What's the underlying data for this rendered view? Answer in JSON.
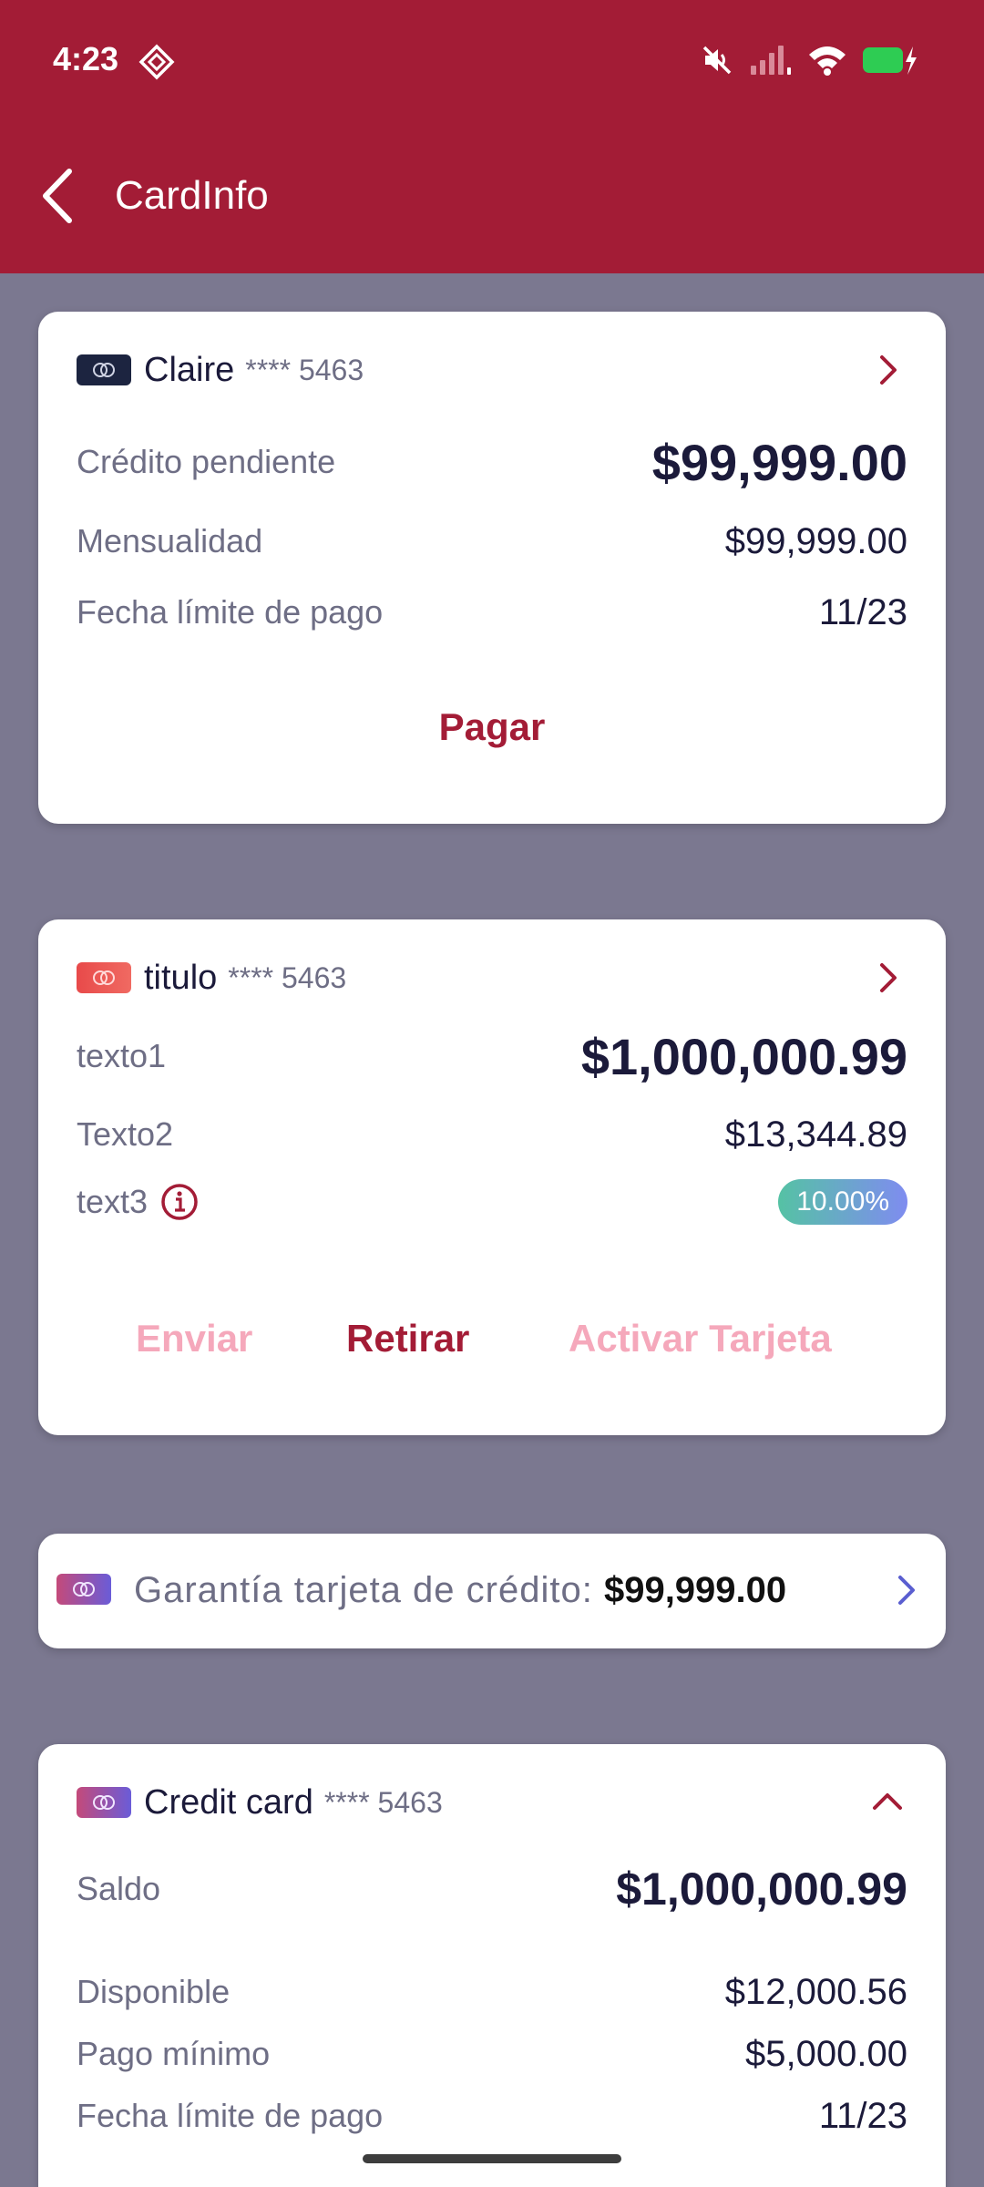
{
  "status": {
    "time": "4:23"
  },
  "header": {
    "title": "CardInfo"
  },
  "card1": {
    "name": "Claire",
    "mask": "**** 5463",
    "rows": [
      {
        "label": "Crédito pendiente",
        "value": "$99,999.00"
      },
      {
        "label": "Mensualidad",
        "value": "$99,999.00"
      },
      {
        "label": "Fecha límite de pago",
        "value": "11/23"
      }
    ],
    "action": "Pagar"
  },
  "card2": {
    "name": "titulo",
    "mask": "**** 5463",
    "rows": [
      {
        "label": "texto1",
        "value": "$1,000,000.99"
      },
      {
        "label": "Texto2",
        "value": "$13,344.89"
      },
      {
        "label": "text3",
        "value": "10.00%"
      }
    ],
    "actions": [
      "Enviar",
      "Retirar",
      "Activar Tarjeta"
    ]
  },
  "guarantee": {
    "label": "Garantía tarjeta de crédito:",
    "value": "$99,999.00"
  },
  "card3": {
    "name": "Credit card",
    "mask": "**** 5463",
    "rows": [
      {
        "label": "Saldo",
        "value": "$1,000,000.99"
      },
      {
        "label": "Disponible",
        "value": "$12,000.56"
      },
      {
        "label": "Pago mínimo",
        "value": "$5,000.00"
      },
      {
        "label": "Fecha límite de pago",
        "value": "11/23"
      }
    ]
  },
  "colors": {
    "brand": "#a31c36",
    "background": "#7b7890",
    "disabled_action": "#f5a8bb",
    "text_dark": "#1b1a3a",
    "text_muted": "#6e6e85"
  },
  "icons": [
    "diamond-icon",
    "mute-icon",
    "signal-icon",
    "wifi-icon",
    "battery-icon",
    "back-arrow-icon",
    "card-chip-icon",
    "chevron-right-icon",
    "chevron-up-icon",
    "info-icon"
  ]
}
